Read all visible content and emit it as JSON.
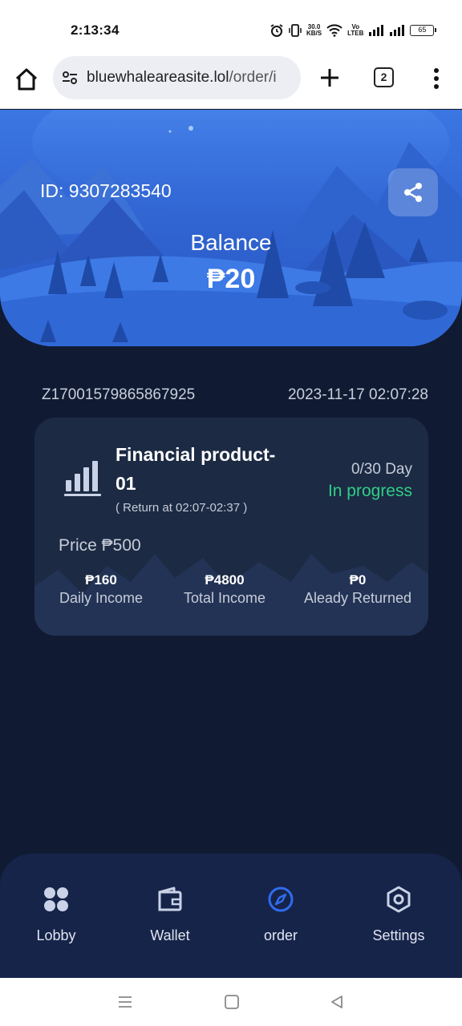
{
  "status_bar": {
    "time": "2:13:34",
    "speed_value": "30.0",
    "speed_unit": "KB/S",
    "network_label_top": "Vo",
    "network_label_bottom": "LTEB",
    "battery": "65"
  },
  "browser": {
    "url_domain": "bluewhaleareasite.lol",
    "url_path": "/order/i",
    "tab_count": "2"
  },
  "hero": {
    "id_text": "ID: 9307283540",
    "balance_label": "Balance",
    "balance_value": "₱20"
  },
  "order": {
    "order_number": "Z17001579865867925",
    "timestamp": "2023-11-17 02:07:28",
    "product_name": "Financial product-01",
    "return_time": "( Return at 02:07-02:37 )",
    "day_progress": "0/30 Day",
    "status": "In progress",
    "status_color": "#2fcf85",
    "price_text": "Price ₱500",
    "stats": [
      {
        "value": "₱160",
        "label": "Daily Income"
      },
      {
        "value": "₱4800",
        "label": "Total Income"
      },
      {
        "value": "₱0",
        "label": "Aleady Returned"
      }
    ]
  },
  "nav": {
    "items": [
      {
        "label": "Lobby",
        "icon": "grid-icon"
      },
      {
        "label": "Wallet",
        "icon": "wallet-icon"
      },
      {
        "label": "order",
        "icon": "compass-icon",
        "active": true
      },
      {
        "label": "Settings",
        "icon": "hexagon-settings-icon"
      }
    ],
    "active_color": "#2f6cf0"
  }
}
